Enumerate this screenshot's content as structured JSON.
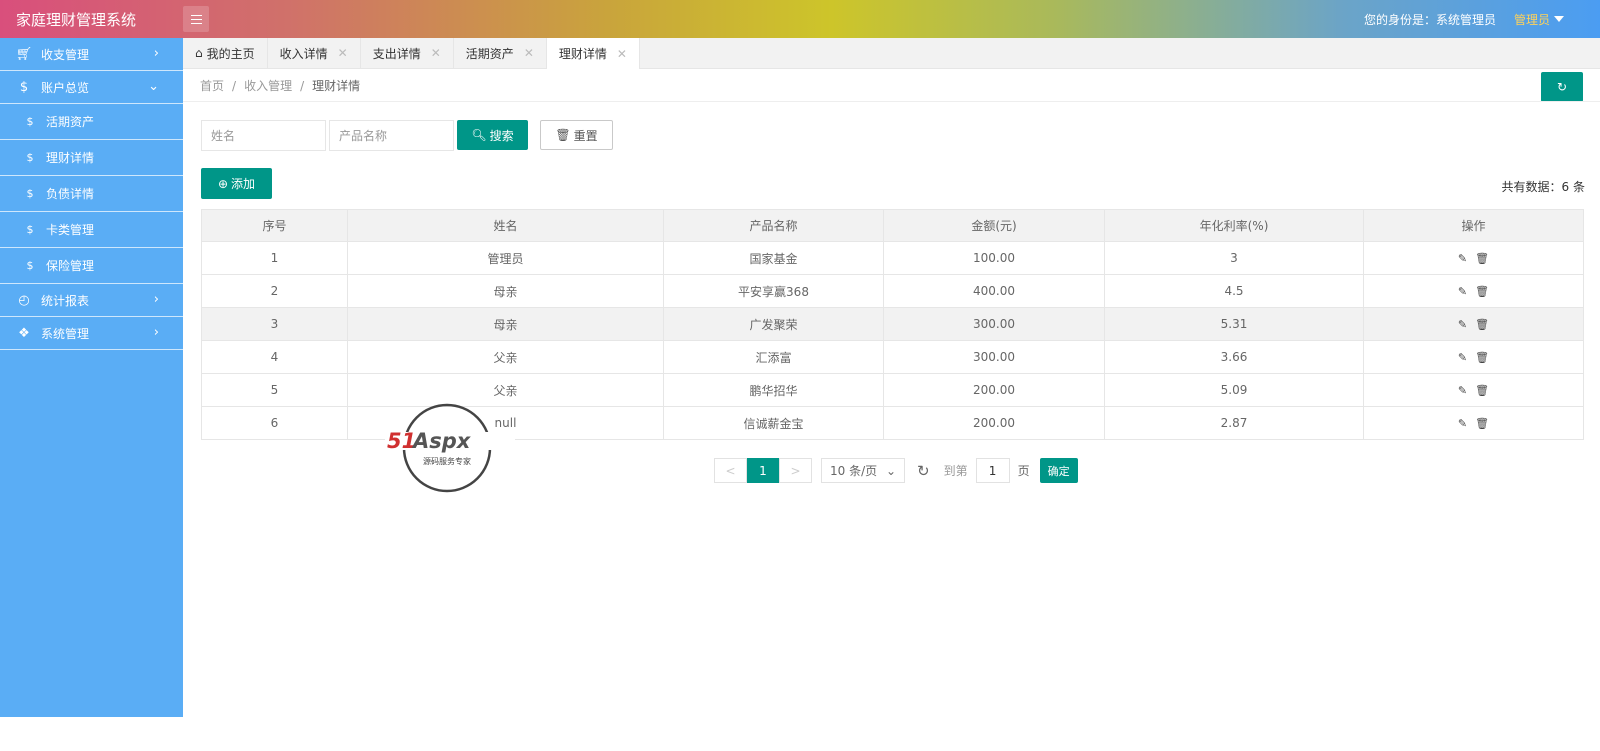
{
  "header": {
    "app_title": "家庭理财管理系统",
    "identity_label": "您的身份是：系统管理员",
    "user_name": "管理员"
  },
  "sidebar": {
    "items": [
      {
        "label": "收支管理",
        "icon": "cart-icon",
        "chevron": ">"
      },
      {
        "label": "账户总览",
        "icon": "dollar-icon",
        "chevron": "v"
      },
      {
        "label": "活期资产",
        "icon": "dollar-icon"
      },
      {
        "label": "理财详情",
        "icon": "dollar-icon"
      },
      {
        "label": "负债详情",
        "icon": "dollar-icon"
      },
      {
        "label": "卡类管理",
        "icon": "dollar-icon"
      },
      {
        "label": "保险管理",
        "icon": "dollar-icon"
      },
      {
        "label": "统计报表",
        "icon": "chart-icon",
        "chevron": ">"
      },
      {
        "label": "系统管理",
        "icon": "grid-icon",
        "chevron": ">"
      }
    ]
  },
  "tabs": [
    {
      "label": "我的主页"
    },
    {
      "label": "收入详情"
    },
    {
      "label": "支出详情"
    },
    {
      "label": "活期资产"
    },
    {
      "label": "理财详情",
      "active": true
    }
  ],
  "breadcrumb": {
    "home": "首页",
    "parent": "收入管理",
    "current": "理财详情"
  },
  "search": {
    "name_placeholder": "姓名",
    "product_placeholder": "产品名称",
    "search_label": "搜索",
    "reset_label": "重置"
  },
  "toolbar": {
    "add_label": "添加",
    "total_text": "共有数据：6 条"
  },
  "table": {
    "columns": [
      "序号",
      "姓名",
      "产品名称",
      "金额(元)",
      "年化利率(%)",
      "操作"
    ],
    "rows": [
      [
        "1",
        "管理员",
        "国家基金",
        "100.00",
        "3"
      ],
      [
        "2",
        "母亲",
        "平安享赢368",
        "400.00",
        "4.5"
      ],
      [
        "3",
        "母亲",
        "广发聚荣",
        "300.00",
        "5.31"
      ],
      [
        "4",
        "父亲",
        "汇添富",
        "300.00",
        "3.66"
      ],
      [
        "5",
        "父亲",
        "鹏华招华",
        "200.00",
        "5.09"
      ],
      [
        "6",
        "null",
        "信诚薪金宝",
        "200.00",
        "2.87"
      ]
    ]
  },
  "pagination": {
    "prev": "<",
    "current_page": "1",
    "next": ">",
    "page_size": "10 条/页",
    "goto_label": "到第",
    "goto_value": "1",
    "page_unit": "页",
    "confirm_label": "确定"
  },
  "watermark": {
    "brand": "51Aspx",
    "tagline": "源码服务专家"
  },
  "colors": {
    "accent": "#009688",
    "sidebar": "#5aadf5"
  }
}
